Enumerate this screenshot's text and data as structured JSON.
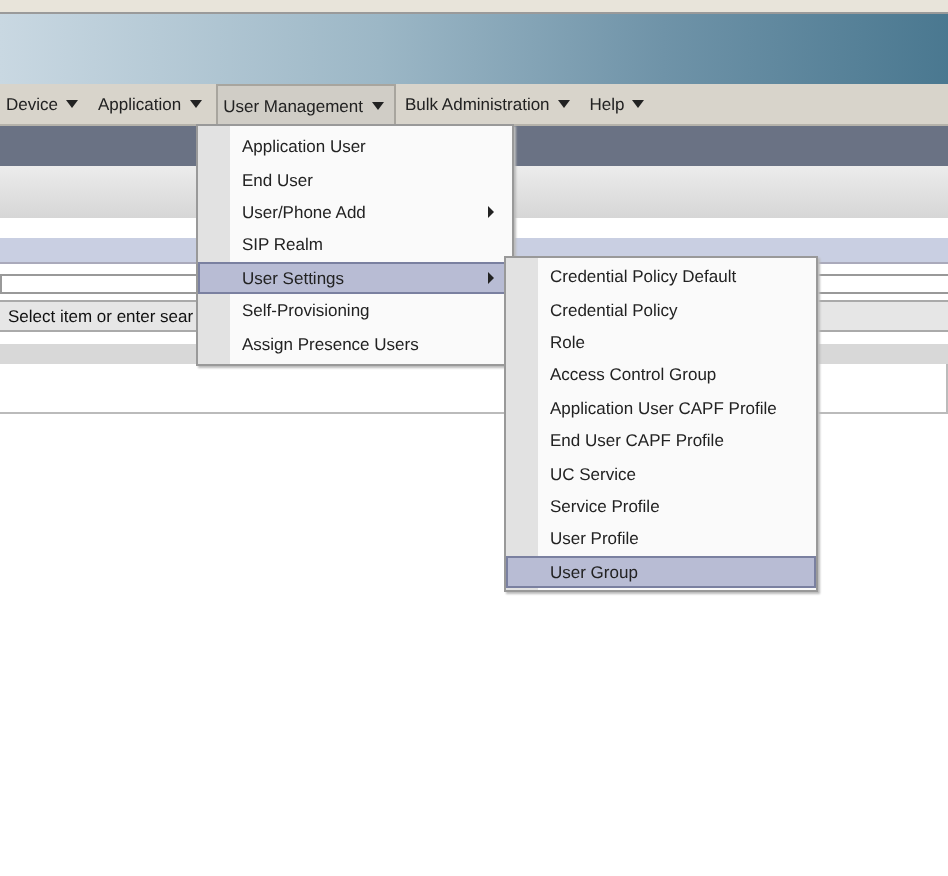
{
  "menubar": [
    {
      "label": "Device",
      "selected": false
    },
    {
      "label": "Application",
      "selected": false
    },
    {
      "label": "User Management",
      "selected": true
    },
    {
      "label": "Bulk Administration",
      "selected": false
    },
    {
      "label": "Help",
      "selected": false
    }
  ],
  "search": {
    "value": "Select item or enter sear"
  },
  "dropdown": [
    {
      "label": "Application User",
      "submenu": false,
      "selected": false
    },
    {
      "label": "End User",
      "submenu": false,
      "selected": false
    },
    {
      "label": "User/Phone Add",
      "submenu": true,
      "selected": false
    },
    {
      "label": "SIP Realm",
      "submenu": false,
      "selected": false
    },
    {
      "label": "User Settings",
      "submenu": true,
      "selected": true
    },
    {
      "label": "Self-Provisioning",
      "submenu": false,
      "selected": false
    },
    {
      "label": "Assign Presence Users",
      "submenu": false,
      "selected": false
    }
  ],
  "submenu": [
    {
      "label": "Credential Policy Default",
      "selected": false
    },
    {
      "label": "Credential Policy",
      "selected": false
    },
    {
      "label": "Role",
      "selected": false
    },
    {
      "label": "Access Control Group",
      "selected": false
    },
    {
      "label": "Application User CAPF Profile",
      "selected": false
    },
    {
      "label": "End User CAPF Profile",
      "selected": false
    },
    {
      "label": "UC Service",
      "selected": false
    },
    {
      "label": "Service Profile",
      "selected": false
    },
    {
      "label": "User Profile",
      "selected": false
    },
    {
      "label": "User Group",
      "selected": true
    }
  ]
}
